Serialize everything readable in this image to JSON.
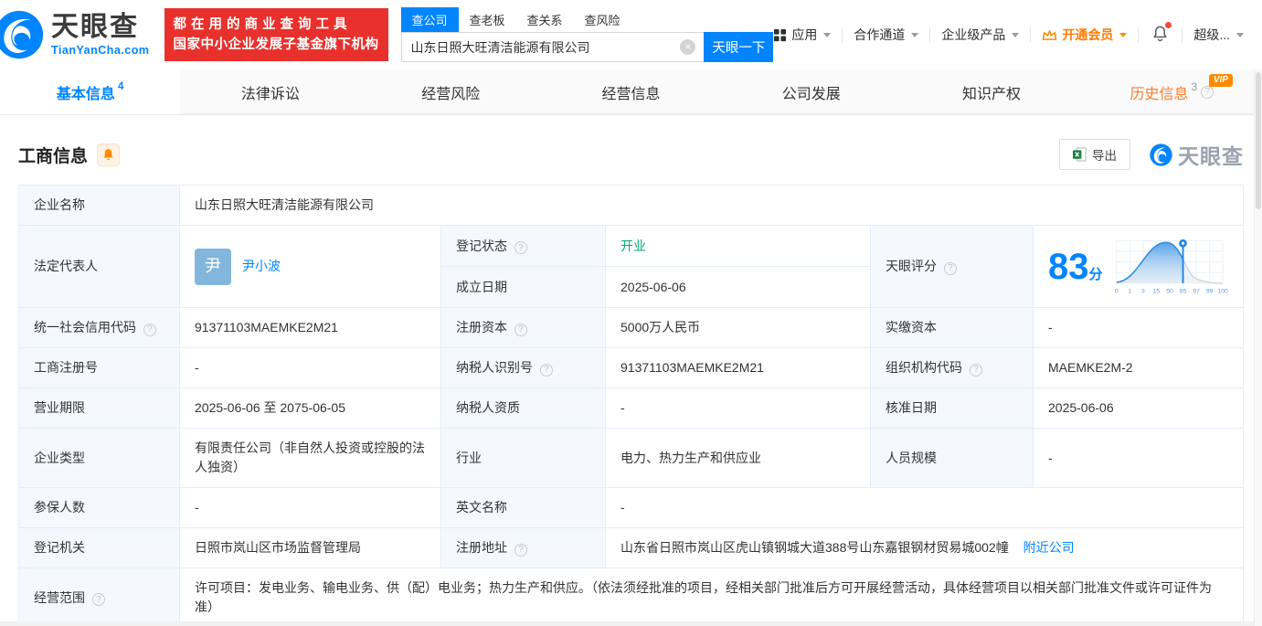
{
  "colors": {
    "accent_blue": "#0084ff",
    "status_green": "#00a96c",
    "member_orange": "#ff7b00",
    "promo_red": "#e8312d"
  },
  "header": {
    "logo": {
      "title": "天眼查",
      "subtitle": "TianYanCha.com"
    },
    "promo": {
      "line1": "都在用的商业查询工具",
      "line2": "国家中小企业发展子基金旗下机构"
    },
    "search": {
      "tabs": [
        {
          "label": "查公司",
          "active": true
        },
        {
          "label": "查老板",
          "active": false
        },
        {
          "label": "查关系",
          "active": false
        },
        {
          "label": "查风险",
          "active": false
        }
      ],
      "value": "山东日照大旺清洁能源有限公司",
      "button": "天眼一下"
    },
    "menu": {
      "apps": "应用",
      "channel": "合作通道",
      "enterprise": "企业级产品",
      "member": "开通会员",
      "super": "超级..."
    }
  },
  "nav": {
    "tabs": [
      {
        "label": "基本信息",
        "badge": "4"
      },
      {
        "label": "法律诉讼",
        "badge": ""
      },
      {
        "label": "经营风险",
        "badge": ""
      },
      {
        "label": "经营信息",
        "badge": ""
      },
      {
        "label": "公司发展",
        "badge": ""
      },
      {
        "label": "知识产权",
        "badge": ""
      },
      {
        "label": "历史信息",
        "badge": "3",
        "vip": "VIP"
      }
    ]
  },
  "section": {
    "title": "工商信息",
    "export_label": "导出",
    "brand": "天眼查"
  },
  "info": {
    "company_name": {
      "label": "企业名称",
      "value": "山东日照大旺清洁能源有限公司"
    },
    "legal_rep": {
      "label": "法定代表人",
      "avatar": "尹",
      "name": "尹小波"
    },
    "reg_status": {
      "label": "登记状态",
      "value": "开业"
    },
    "est_date": {
      "label": "成立日期",
      "value": "2025-06-06"
    },
    "score": {
      "label": "天眼评分",
      "value": "83",
      "unit": "分",
      "ticks": [
        "0",
        "1",
        "3",
        "15",
        "50",
        "85",
        "97",
        "99",
        "100"
      ]
    },
    "credit_code": {
      "label": "统一社会信用代码",
      "value": "91371103MAEMKE2M21"
    },
    "reg_capital": {
      "label": "注册资本",
      "value": "5000万人民币"
    },
    "paid_capital": {
      "label": "实缴资本",
      "value": "-"
    },
    "reg_number": {
      "label": "工商注册号",
      "value": "-"
    },
    "taxpayer_id": {
      "label": "纳税人识别号",
      "value": "91371103MAEMKE2M21"
    },
    "org_code": {
      "label": "组织机构代码",
      "value": "MAEMKE2M-2"
    },
    "business_term": {
      "label": "营业期限",
      "value": "2025-06-06 至 2075-06-05"
    },
    "taxpayer_quality": {
      "label": "纳税人资质",
      "value": "-"
    },
    "approval_date": {
      "label": "核准日期",
      "value": "2025-06-06"
    },
    "company_type": {
      "label": "企业类型",
      "value": "有限责任公司（非自然人投资或控股的法人独资）"
    },
    "industry": {
      "label": "行业",
      "value": "电力、热力生产和供应业"
    },
    "staff_size": {
      "label": "人员规模",
      "value": "-"
    },
    "insured_count": {
      "label": "参保人数",
      "value": "-"
    },
    "english_name": {
      "label": "英文名称",
      "value": "-"
    },
    "reg_authority": {
      "label": "登记机关",
      "value": "日照市岚山区市场监督管理局"
    },
    "reg_address": {
      "label": "注册地址",
      "value": "山东省日照市岚山区虎山镇钢城大道388号山东嘉银钢材贸易城002幢",
      "link": "附近公司"
    },
    "business_scope": {
      "label": "经营范围",
      "value": "许可项目：发电业务、输电业务、供（配）电业务；热力生产和供应。（依法须经批准的项目，经相关部门批准后方可开展经营活动，具体经营项目以相关部门批准文件或许可证件为准）"
    }
  }
}
